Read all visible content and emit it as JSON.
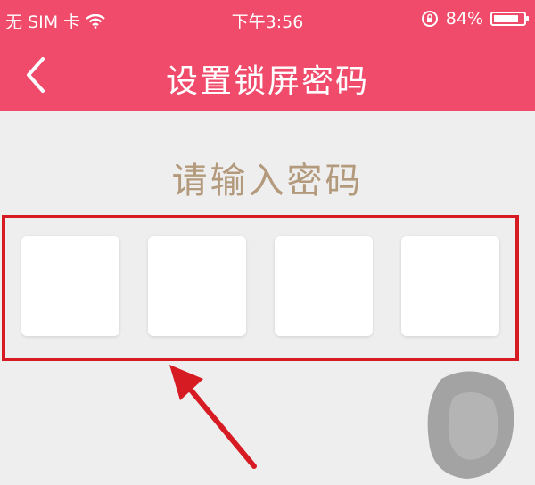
{
  "status_bar": {
    "carrier": "无 SIM 卡",
    "time": "下午3:56",
    "battery_percent": "84%",
    "battery_level": 0.84,
    "icons": [
      "wifi-icon",
      "rotation-lock-icon",
      "battery-icon"
    ]
  },
  "nav": {
    "title": "设置锁屏密码",
    "back_icon": "chevron-left-icon"
  },
  "prompt": "请输入密码",
  "pin": {
    "digits": 4,
    "values": [
      "",
      "",
      "",
      ""
    ]
  },
  "annotation": {
    "highlight_color": "#d71b22",
    "arrow_color": "#d71b22"
  },
  "colors": {
    "header": "#f04b6b",
    "background": "#eeeeee",
    "prompt_text": "#b39a7c"
  }
}
